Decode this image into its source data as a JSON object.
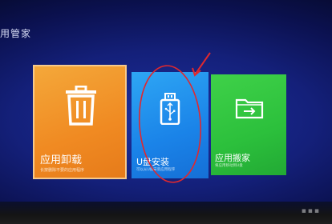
{
  "screen": {
    "title": "用管家"
  },
  "cards": [
    {
      "label": "应用卸载",
      "sub": "长按删除不要的应用程序",
      "icon": "trash-icon",
      "color": "#f08a22"
    },
    {
      "label": "U盘安装",
      "sub": "可以从U盘安装应用程序",
      "icon": "usb-drive-icon",
      "color": "#1a83e8"
    },
    {
      "label": "应用搬家",
      "sub": "将应用移动到U盘",
      "icon": "folder-move-icon",
      "color": "#2cc03c"
    }
  ],
  "annotation": {
    "shape": "ellipse-and-arrow",
    "color": "#e0282e"
  },
  "watermark": {
    "text": "▪▪▪"
  }
}
